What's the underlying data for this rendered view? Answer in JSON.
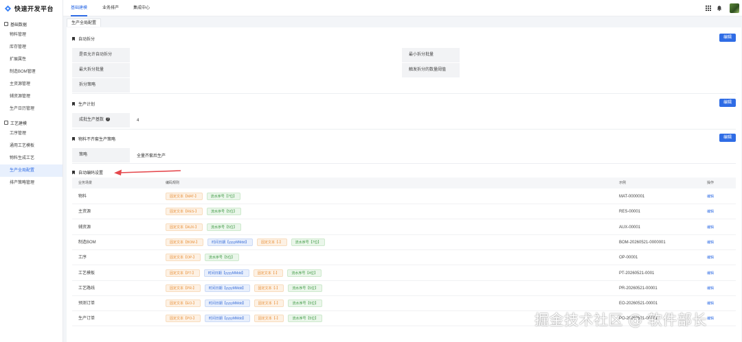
{
  "app": {
    "title": "快速开发平台"
  },
  "sidebar": {
    "groups": [
      {
        "label": "基础数据",
        "items": [
          "物料管理",
          "库存管理",
          "扩展属性",
          "制造BOM管理",
          "主资源管理",
          "辅资源管理",
          "生产日历管理"
        ]
      },
      {
        "label": "工艺建模",
        "items": [
          "工序管理",
          "通用工艺模板",
          "物料生成工艺",
          "生产全局配置",
          "排产策略管理"
        ]
      }
    ],
    "active_item": "生产全局配置"
  },
  "topbar": {
    "tabs": [
      "基础建模",
      "业务排产",
      "集成中心"
    ],
    "active_tab": "基础建模"
  },
  "page_tab": "生产全局配置",
  "sections": {
    "auto_split": {
      "title": "自动拆分",
      "edit": "编辑",
      "fields": {
        "allow_auto_split": "是否允许自动拆分",
        "min_batch": "最小拆分批量",
        "max_batch": "最大拆分批量",
        "trigger_threshold": "触发拆分的数量阈值",
        "strategy": "拆分策略"
      }
    },
    "production_plan": {
      "title": "生产计划",
      "edit": "编辑",
      "field_label": "成批生产基数",
      "field_value": "4"
    },
    "material_strategy": {
      "title": "物料不齐套生产策略",
      "edit": "编辑",
      "field_label": "策略",
      "field_value": "全量齐套后生产"
    },
    "auto_coding": {
      "title": "自动编码设置",
      "columns": {
        "scene": "业务场景",
        "rule": "编码规则",
        "example": "示例",
        "op": "操作"
      },
      "rows": [
        {
          "scene": "物料",
          "tags": [
            {
              "t": "固定文本【MAT-】",
              "c": "orange"
            },
            {
              "t": "流水序号【7位】",
              "c": "green"
            }
          ],
          "example": "MAT-0000001",
          "op": "编辑"
        },
        {
          "scene": "主资源",
          "tags": [
            {
              "t": "固定文本【RES-】",
              "c": "orange"
            },
            {
              "t": "流水序号【5位】",
              "c": "green"
            }
          ],
          "example": "RES-00001",
          "op": "编辑"
        },
        {
          "scene": "辅资源",
          "tags": [
            {
              "t": "固定文本【AUX-】",
              "c": "orange"
            },
            {
              "t": "流水序号【5位】",
              "c": "green"
            }
          ],
          "example": "AUX-00001",
          "op": "编辑"
        },
        {
          "scene": "制造BOM",
          "tags": [
            {
              "t": "固定文本【BOM-】",
              "c": "orange"
            },
            {
              "t": "时间日期【yyyyMMdd】",
              "c": "blue"
            },
            {
              "t": "固定文本【-】",
              "c": "orange"
            },
            {
              "t": "流水序号【7位】",
              "c": "green"
            }
          ],
          "example": "BOM-20260521-0000001",
          "op": "编辑"
        },
        {
          "scene": "工序",
          "tags": [
            {
              "t": "固定文本【OP-】",
              "c": "orange"
            },
            {
              "t": "流水序号【5位】",
              "c": "green"
            }
          ],
          "example": "OP-00001",
          "op": "编辑"
        },
        {
          "scene": "工艺模板",
          "tags": [
            {
              "t": "固定文本【PT-】",
              "c": "orange"
            },
            {
              "t": "时间日期【yyyyMMdd】",
              "c": "blue"
            },
            {
              "t": "固定文本【-】",
              "c": "orange"
            },
            {
              "t": "流水序号【4位】",
              "c": "green"
            }
          ],
          "example": "PT-20260521-0001",
          "op": "编辑"
        },
        {
          "scene": "工艺路线",
          "tags": [
            {
              "t": "固定文本【PR-】",
              "c": "orange"
            },
            {
              "t": "时间日期【yyyyMMdd】",
              "c": "blue"
            },
            {
              "t": "固定文本【-】",
              "c": "orange"
            },
            {
              "t": "流水序号【5位】",
              "c": "green"
            }
          ],
          "example": "PR-20260521-00001",
          "op": "编辑"
        },
        {
          "scene": "预测订单",
          "tags": [
            {
              "t": "固定文本【EO-】",
              "c": "orange"
            },
            {
              "t": "时间日期【yyyyMMdd】",
              "c": "blue"
            },
            {
              "t": "固定文本【-】",
              "c": "orange"
            },
            {
              "t": "流水序号【5位】",
              "c": "green"
            }
          ],
          "example": "EO-20260521-00001",
          "op": "编辑"
        },
        {
          "scene": "生产订单",
          "tags": [
            {
              "t": "固定文本【PO-】",
              "c": "orange"
            },
            {
              "t": "时间日期【yyyyMMdd】",
              "c": "blue"
            },
            {
              "t": "固定文本【-】",
              "c": "orange"
            },
            {
              "t": "流水序号【5位】",
              "c": "green"
            }
          ],
          "example": "PO-20260521-00001",
          "op": "编辑"
        }
      ]
    }
  },
  "watermark": "掘金技术社区 @ 软件部长",
  "colors": {
    "primary": "#2f6ce5",
    "arrow": "#e5484d"
  }
}
